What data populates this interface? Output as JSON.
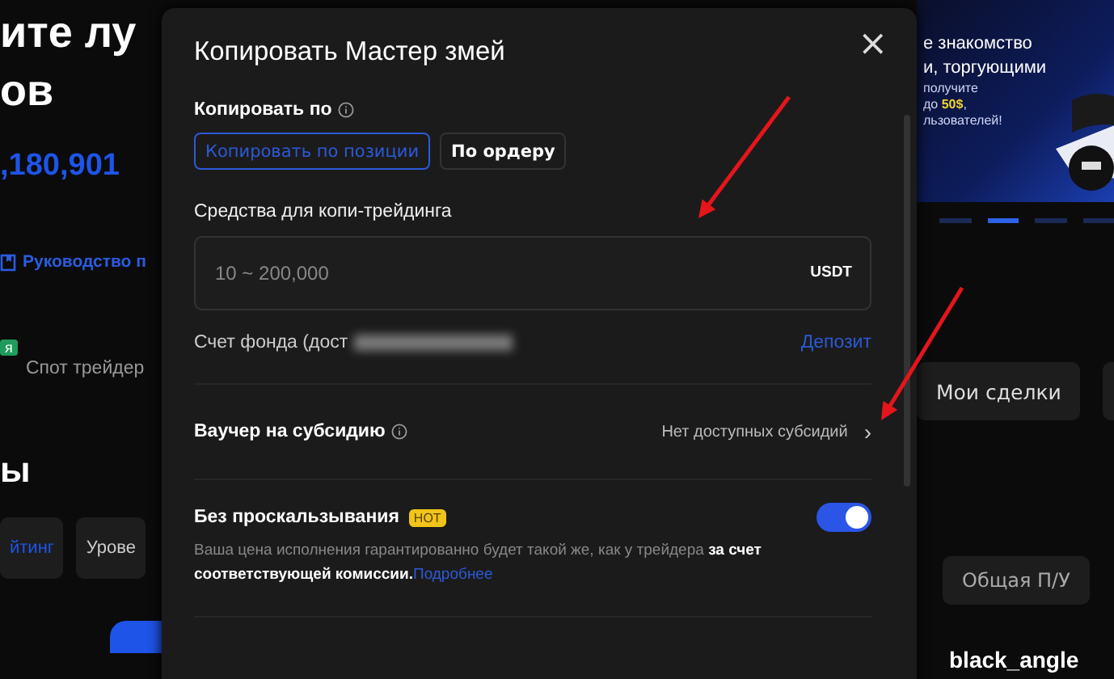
{
  "background": {
    "heading_lines": [
      "ите лу",
      "ов"
    ],
    "total": ",180,901",
    "guide_link": "Руководство п",
    "badge": "я",
    "trader_type": "Спот трейдер",
    "section_heading": "ы",
    "filters": [
      {
        "label": "йтинг",
        "selected": true
      },
      {
        "label": "Урове",
        "selected": false
      }
    ],
    "banner": {
      "title_lines": [
        "е знакомство",
        "и, торгующими"
      ],
      "text_lines": [
        "получите",
        "до **50$**,",
        "льзователей!"
      ],
      "dots": [
        {
          "selected": false
        },
        {
          "selected": true
        },
        {
          "selected": false
        },
        {
          "selected": false
        }
      ]
    },
    "my_trades_button": "Мои сделки",
    "pnl_filter": "Общая П/У",
    "trader_name": "black_angle"
  },
  "modal": {
    "title": "Копировать Мастер змей",
    "close": "×",
    "copy_mode_label": "Копировать по",
    "copy_modes": [
      {
        "label": "Копировать по позиции",
        "selected": true
      },
      {
        "label": "По ордеру",
        "selected": false
      }
    ],
    "funds_label": "Средства для копи-трейдинга",
    "funds_field": {
      "placeholder": "10 ~ 200,000",
      "unit": "USDT"
    },
    "fund_account": "Счет фонда (дост",
    "deposit_link": "Депозит",
    "voucher_label": "Ваучер на субсидию",
    "voucher_value": "Нет доступных субсидий",
    "chevron": "›",
    "slippage_label": "Без проскальзывания",
    "hot_badge": "HOT",
    "slippage_on": true,
    "slippage_text": "Ваша цена исполнения гарантированно будет такой же, как у трейдера **за счет соответствующей комиссии.**",
    "more_link": "Подробнее"
  },
  "annotations": [
    {
      "kind": "arrow"
    },
    {
      "kind": "arrow"
    }
  ]
}
